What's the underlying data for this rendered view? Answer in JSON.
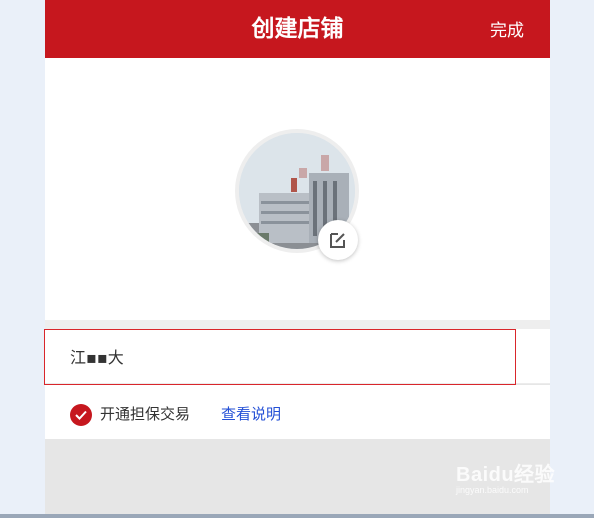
{
  "header": {
    "title": "创建店铺",
    "done_label": "完成"
  },
  "avatar": {
    "icon": "store-photo",
    "edit_icon": "edit-icon"
  },
  "store_name": {
    "value": "江▪▪大"
  },
  "guarantee": {
    "checked": true,
    "label": "开通担保交易",
    "link_label": "查看说明"
  },
  "watermark": {
    "brand": "Baidu经验",
    "sub": "jingyan.baidu.com"
  },
  "colors": {
    "brand_red": "#c6171e",
    "link_blue": "#2450d6",
    "highlight_border": "#d9262b"
  }
}
